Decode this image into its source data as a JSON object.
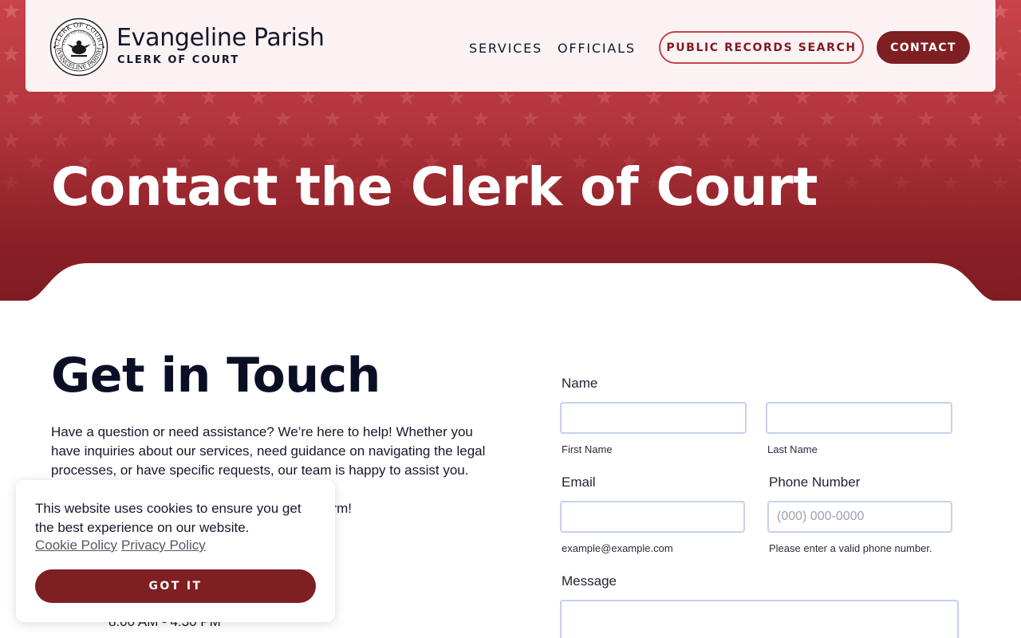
{
  "header": {
    "brand_name": "Evangeline Parish",
    "brand_sub": "CLERK OF COURT",
    "seal_text_top": "CLERK OF COURT",
    "seal_text_bottom": "EVANGELINE PARISH",
    "seal_text_inner": "STATE OF LOUISIANA",
    "nav": {
      "services": "SERVICES",
      "officials": "OFFICIALS",
      "records": "PUBLIC RECORDS SEARCH",
      "contact": "CONTACT"
    }
  },
  "hero": {
    "title": "Contact the Clerk of Court"
  },
  "main": {
    "title": "Get in Touch",
    "intro": "Have a question or need assistance? We’re here to help! Whether you have inquiries about our services, need guidance on navigating the legal processes, or have specific requests, our team is happy to assist you. Call",
    "intro_tail": "orm!",
    "hours": "8:00 AM - 4:30 PM"
  },
  "cookie": {
    "text": "This website uses cookies to ensure you get the best experience on our website.",
    "cookie_policy": "Cookie Policy",
    "privacy_policy": "Privacy Policy",
    "button": "GOT IT"
  },
  "form": {
    "name_label": "Name",
    "first_name_value": "",
    "first_name_sub": "First Name",
    "last_name_value": "",
    "last_name_sub": "Last Name",
    "email_label": "Email",
    "email_value": "",
    "email_sub": "example@example.com",
    "phone_label": "Phone Number",
    "phone_placeholder": "(000) 000-0000",
    "phone_sub": "Please enter a valid phone number.",
    "message_label": "Message",
    "message_value": ""
  },
  "colors": {
    "brand_red": "#7e1f22",
    "hero_red": "#b3353d",
    "accent_outline": "#c2454c",
    "input_border": "#c5d1f0"
  }
}
